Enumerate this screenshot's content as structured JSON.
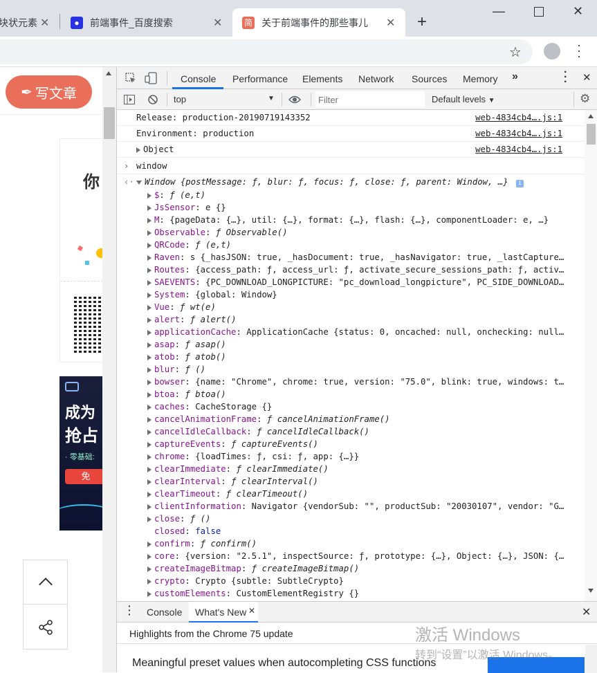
{
  "tabs": [
    {
      "title": "块状元素"
    },
    {
      "title": "前端事件_百度搜索"
    },
    {
      "title": "关于前端事件的那些事儿"
    }
  ],
  "page": {
    "write_button": "写文章",
    "ad_text1": "你",
    "ad_heading1": "成为",
    "ad_heading2": "抢占",
    "ad_sub": "· 零基础:",
    "ad_btn": "免"
  },
  "devtools": {
    "tabs": [
      "Console",
      "Performance",
      "Elements",
      "Network",
      "Sources",
      "Memory"
    ],
    "context": "top",
    "filter_placeholder": "Filter",
    "levels": "Default levels",
    "source_file": "web-4834cb4….js:1",
    "messages": [
      {
        "text": "Release: production-20190719143352"
      },
      {
        "text": "Environment: production"
      },
      {
        "text": "Object"
      }
    ],
    "input_cmd": "window",
    "window_summary": "Window {postMessage: ƒ, blur: ƒ, focus: ƒ, close: ƒ, parent: Window, …}",
    "props": [
      {
        "k": "$",
        "v": "ƒ (e,t)"
      },
      {
        "k": "JsSensor",
        "v": "e {}"
      },
      {
        "k": "M",
        "v": "{pageData: {…}, util: {…}, format: {…}, flash: {…}, componentLoader: e, …}"
      },
      {
        "k": "Observable",
        "v": "ƒ Observable()"
      },
      {
        "k": "QRCode",
        "v": "ƒ (e,t)"
      },
      {
        "k": "Raven",
        "v": "s {_hasJSON: true, _hasDocument: true, _hasNavigator: true, _lastCapture…"
      },
      {
        "k": "Routes",
        "v": "{access_path: ƒ, access_url: ƒ, activate_secure_sessions_path: ƒ, activ…"
      },
      {
        "k": "SAEVENTS",
        "v": "{PC_DOWNLOAD_LONGPICTURE: \"pc_download_longpicture\", PC_SIDE_DOWNLOAD…"
      },
      {
        "k": "System",
        "v": "{global: Window}"
      },
      {
        "k": "Vue",
        "v": "ƒ wt(e)"
      },
      {
        "k": "alert",
        "v": "ƒ alert()"
      },
      {
        "k": "applicationCache",
        "v": "ApplicationCache {status: 0, oncached: null, onchecking: null…"
      },
      {
        "k": "asap",
        "v": "ƒ asap()"
      },
      {
        "k": "atob",
        "v": "ƒ atob()"
      },
      {
        "k": "blur",
        "v": "ƒ ()"
      },
      {
        "k": "bowser",
        "v": "{name: \"Chrome\", chrome: true, version: \"75.0\", blink: true, windows: t…"
      },
      {
        "k": "btoa",
        "v": "ƒ btoa()"
      },
      {
        "k": "caches",
        "v": "CacheStorage {}"
      },
      {
        "k": "cancelAnimationFrame",
        "v": "ƒ cancelAnimationFrame()"
      },
      {
        "k": "cancelIdleCallback",
        "v": "ƒ cancelIdleCallback()"
      },
      {
        "k": "captureEvents",
        "v": "ƒ captureEvents()"
      },
      {
        "k": "chrome",
        "v": "{loadTimes: ƒ, csi: ƒ, app: {…}}"
      },
      {
        "k": "clearImmediate",
        "v": "ƒ clearImmediate()"
      },
      {
        "k": "clearInterval",
        "v": "ƒ clearInterval()"
      },
      {
        "k": "clearTimeout",
        "v": "ƒ clearTimeout()"
      },
      {
        "k": "clientInformation",
        "v": "Navigator {vendorSub: \"\", productSub: \"20030107\", vendor: \"G…"
      },
      {
        "k": "close",
        "v": "ƒ ()"
      },
      {
        "k": "closed",
        "v": "false"
      },
      {
        "k": "confirm",
        "v": "ƒ confirm()"
      },
      {
        "k": "core",
        "v": "{version: \"2.5.1\", inspectSource: ƒ, prototype: {…}, Object: {…}, JSON: {…"
      },
      {
        "k": "createImageBitmap",
        "v": "ƒ createImageBitmap()"
      },
      {
        "k": "crypto",
        "v": "Crypto {subtle: SubtleCrypto}"
      },
      {
        "k": "customElements",
        "v": "CustomElementRegistry {}"
      }
    ],
    "drawer_tabs": [
      "Console",
      "What's New"
    ],
    "highlights": "Highlights from the Chrome 75 update",
    "whatsnew_item": "Meaningful preset values when autocompleting CSS functions"
  },
  "watermark": {
    "line1": "激活 Windows",
    "line2": "转到“设置”以激活 Windows。"
  },
  "colors": {
    "brand": "#ea6f5a",
    "accent": "#1a73e8"
  }
}
